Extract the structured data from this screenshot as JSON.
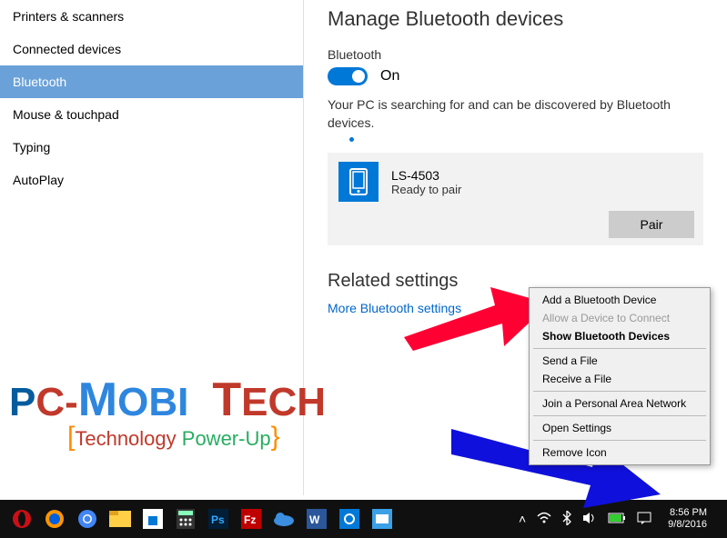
{
  "sidebar": {
    "items": [
      {
        "label": "Printers & scanners"
      },
      {
        "label": "Connected devices"
      },
      {
        "label": "Bluetooth"
      },
      {
        "label": "Mouse & touchpad"
      },
      {
        "label": "Typing"
      },
      {
        "label": "AutoPlay"
      }
    ]
  },
  "main": {
    "title": "Manage Bluetooth devices",
    "bt_label": "Bluetooth",
    "toggle_state": "On",
    "status_text": "Your PC is searching for and can be discovered by Bluetooth devices.",
    "device": {
      "name": "LS-4503",
      "status": "Ready to pair",
      "pair_label": "Pair"
    },
    "related_title": "Related settings",
    "related_link": "More Bluetooth settings"
  },
  "context_menu": {
    "items": [
      {
        "label": "Add a Bluetooth Device",
        "disabled": false,
        "bold": false
      },
      {
        "label": "Allow a Device to Connect",
        "disabled": true,
        "bold": false
      },
      {
        "label": "Show Bluetooth Devices",
        "disabled": false,
        "bold": true
      },
      {
        "sep": true
      },
      {
        "label": "Send a File",
        "disabled": false,
        "bold": false
      },
      {
        "label": "Receive a File",
        "disabled": false,
        "bold": false
      },
      {
        "sep": true
      },
      {
        "label": "Join a Personal Area Network",
        "disabled": false,
        "bold": false
      },
      {
        "sep": true
      },
      {
        "label": "Open Settings",
        "disabled": false,
        "bold": false
      },
      {
        "sep": true
      },
      {
        "label": "Remove Icon",
        "disabled": false,
        "bold": false
      }
    ]
  },
  "taskbar": {
    "time": "8:56 PM",
    "date": "9/8/2016"
  },
  "watermark": {
    "brand_prefix": "P",
    "brand_c": "C",
    "brand_dash": "-",
    "brand_m": "M",
    "brand_obi": "OBI",
    "brand_t": "T",
    "brand_ech": "ECH",
    "sub_bracket_l": "[",
    "sub_tech": "Technology ",
    "sub_pow": "Power-Up",
    "sub_bracket_r": "}"
  }
}
